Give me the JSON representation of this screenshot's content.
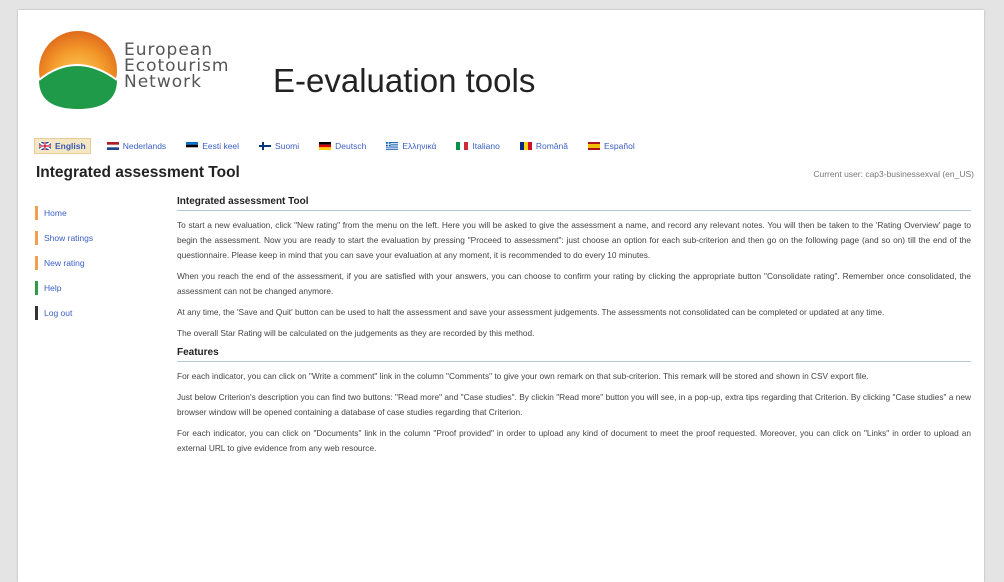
{
  "header": {
    "logo_lines": [
      "European",
      "Ecotourism",
      "Network"
    ],
    "title": "E-evaluation tools"
  },
  "languages": [
    {
      "label": "English",
      "active": true
    },
    {
      "label": "Nederlands",
      "active": false
    },
    {
      "label": "Eesti keel",
      "active": false
    },
    {
      "label": "Suomi",
      "active": false
    },
    {
      "label": "Deutsch",
      "active": false
    },
    {
      "label": "Ελληνικά",
      "active": false
    },
    {
      "label": "Italiano",
      "active": false
    },
    {
      "label": "Română",
      "active": false
    },
    {
      "label": "Español",
      "active": false
    }
  ],
  "tool": {
    "heading": "Integrated assessment Tool",
    "current_user": "Current user: cap3-businessexval (en_US)"
  },
  "sidebar": {
    "items": [
      {
        "label": "Home"
      },
      {
        "label": "Show ratings"
      },
      {
        "label": "New rating"
      },
      {
        "label": "Help"
      },
      {
        "label": "Log out"
      }
    ]
  },
  "main": {
    "section1_title": "Integrated assessment Tool",
    "p1": "To start a new evaluation, click \"New rating\" from the menu on the left. Here you will be asked to give the assessment a name, and record any relevant notes. You will then be taken to the 'Rating Overview' page to begin the assessment. Now you are ready to start the evaluation by pressing \"Proceed to assessment\": just choose an option for each sub-criterion and then go on the following page (and so on) till the end of the questionnaire. Please keep in mind that you can save your evaluation at any moment, it is recommended to do every 10 minutes.",
    "p2": "When you reach the end of the assessment, if you are satisfied with your answers, you can choose to confirm your rating by clicking the appropriate button \"Consolidate rating\". Remember once consolidated, the assessment can not be changed anymore.",
    "p3": "At any time, the 'Save and Quit' button can be used to halt the assessment and save your assessment judgements. The assessments not consolidated can be completed or updated at any time.",
    "p4": "The overall Star Rating will be calculated on the judgements as they are recorded by this method.",
    "section2_title": "Features",
    "p5": "For each indicator, you can click on \"Write a comment\" link in the column \"Comments\" to give your own remark on that sub-criterion. This remark will be stored and shown in CSV export file.",
    "p6": "Just below Criterion's description you can find two buttons: \"Read more\" and \"Case studies\". By clickin \"Read more\" button you will see, in a pop-up, extra tips regarding that Criterion. By clicking \"Case studies\" a new browser window will be opened containing a database of case studies regarding that Criterion.",
    "p7": "For each indicator, you can click on \"Documents\" link in the column \"Proof provided\" in order to upload any kind of document to meet the proof requested. Moreover, you can click on \"Links\" in order to upload an external URL to give evidence from any web resource."
  }
}
